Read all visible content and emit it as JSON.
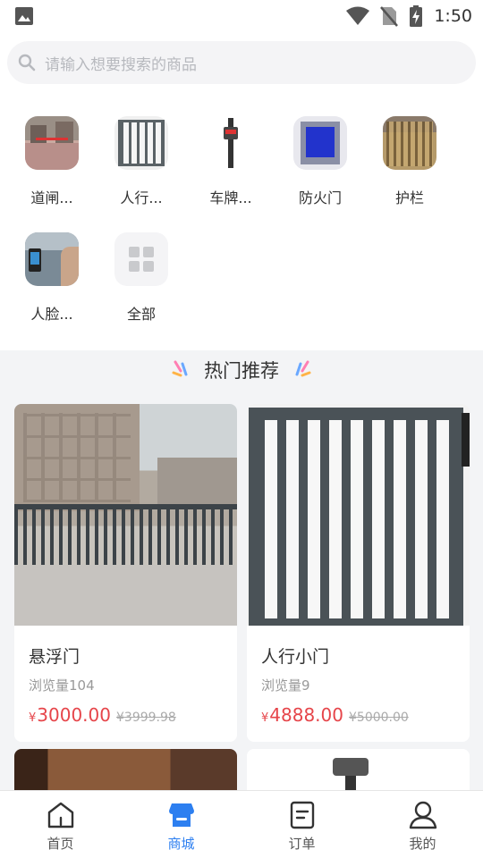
{
  "status": {
    "time": "1:50"
  },
  "search": {
    "placeholder": "请输入想要搜索的商品"
  },
  "categories": [
    {
      "label": "道闸...",
      "icon": "barrier-gate-photo"
    },
    {
      "label": "人行...",
      "icon": "pedestrian-gate-photo"
    },
    {
      "label": "车牌...",
      "icon": "plate-camera-photo"
    },
    {
      "label": "防火门",
      "icon": "fire-door-photo"
    },
    {
      "label": "护栏",
      "icon": "fence-photo"
    },
    {
      "label": "人脸...",
      "icon": "face-recognition-photo"
    },
    {
      "label": "全部",
      "icon": "grid-icon"
    }
  ],
  "section": {
    "title": "热门推荐"
  },
  "products": [
    {
      "title": "悬浮门",
      "views": "浏览量104",
      "currency": "¥",
      "price": "3000.00",
      "old_price": "¥3999.98"
    },
    {
      "title": "人行小门",
      "views": "浏览量9",
      "currency": "¥",
      "price": "4888.00",
      "old_price": "¥5000.00"
    }
  ],
  "tabs": [
    {
      "label": "首页",
      "icon": "home-icon",
      "active": false
    },
    {
      "label": "商城",
      "icon": "shop-icon",
      "active": true
    },
    {
      "label": "订单",
      "icon": "order-icon",
      "active": false
    },
    {
      "label": "我的",
      "icon": "profile-icon",
      "active": false
    }
  ],
  "colors": {
    "accent": "#2d7ff0",
    "price": "#e6454a"
  }
}
